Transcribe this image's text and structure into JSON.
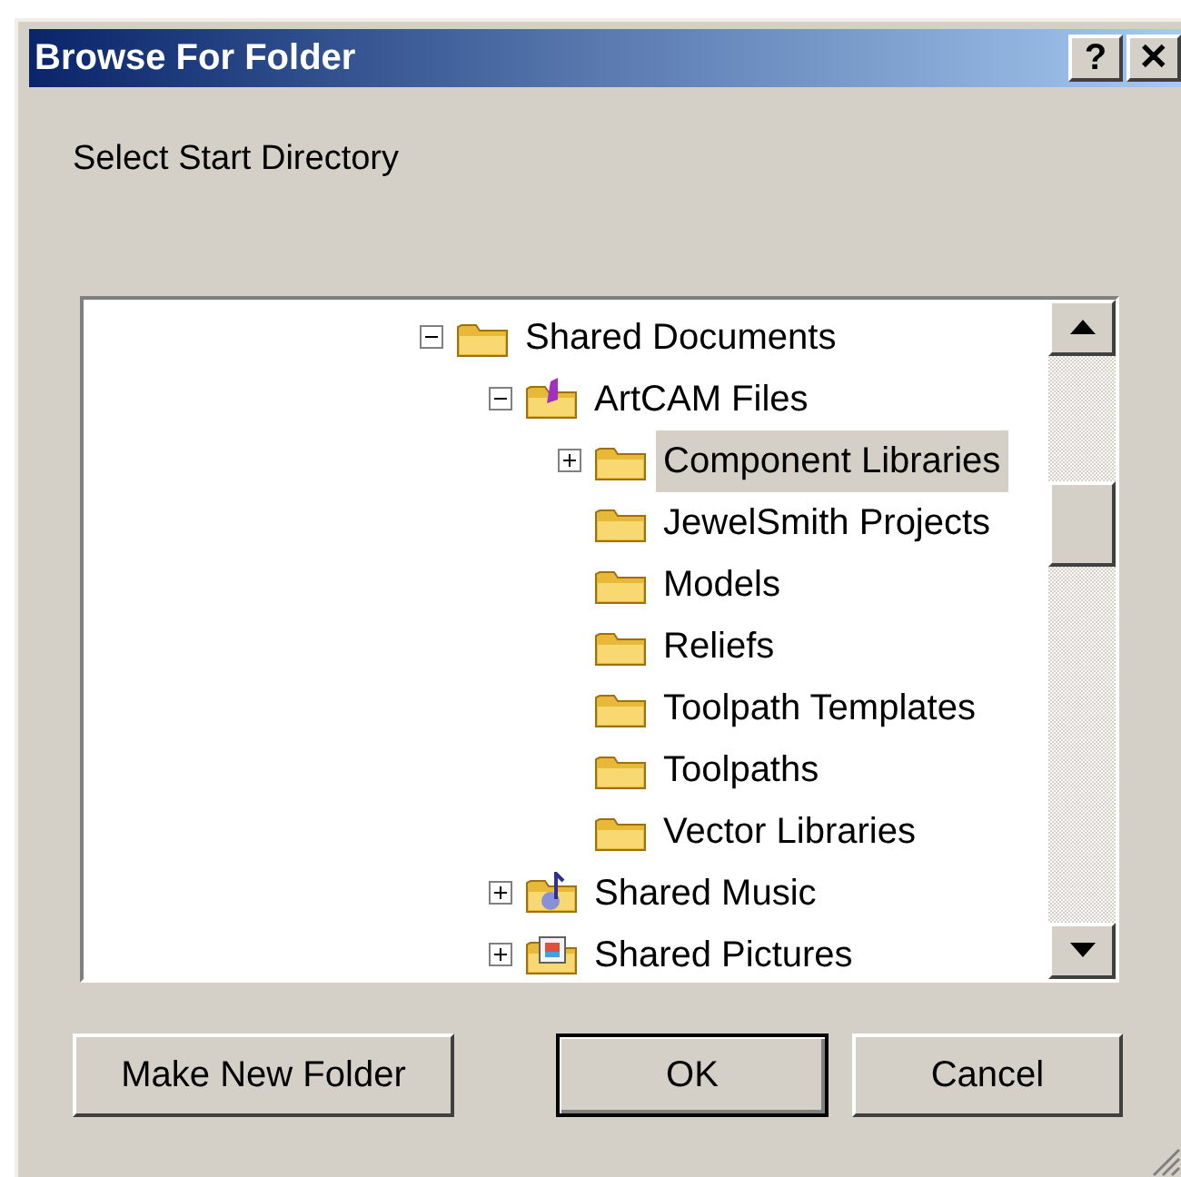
{
  "window": {
    "title": "Browse For Folder",
    "title_buttons": [
      "?",
      "✕"
    ]
  },
  "prompt": "Select Start Directory",
  "tree": [
    {
      "label": "Shared Documents",
      "kind": "folder",
      "selected": false,
      "expanded": true,
      "children": [
        {
          "label": "ArtCAM Files",
          "kind": "app-folder",
          "selected": false,
          "expanded": true,
          "children": [
            {
              "label": "Component Libraries",
              "kind": "folder",
              "selected": true,
              "expanded": false
            },
            {
              "label": "JewelSmith Projects",
              "kind": "folder",
              "selected": false
            },
            {
              "label": "Models",
              "kind": "folder",
              "selected": false
            },
            {
              "label": "Reliefs",
              "kind": "folder",
              "selected": false
            },
            {
              "label": "Toolpath Templates",
              "kind": "folder",
              "selected": false
            },
            {
              "label": "Toolpaths",
              "kind": "folder",
              "selected": false
            },
            {
              "label": "Vector Libraries",
              "kind": "folder",
              "selected": false
            }
          ]
        },
        {
          "label": "Shared Music",
          "kind": "music-folder",
          "selected": false,
          "expanded": false
        },
        {
          "label": "Shared Pictures",
          "kind": "pictures-folder",
          "selected": false,
          "expanded": false
        }
      ]
    }
  ],
  "buttons": [
    {
      "label": "Make New Folder",
      "default": false
    },
    {
      "label": "OK",
      "default": true
    },
    {
      "label": "Cancel",
      "default": false
    }
  ]
}
